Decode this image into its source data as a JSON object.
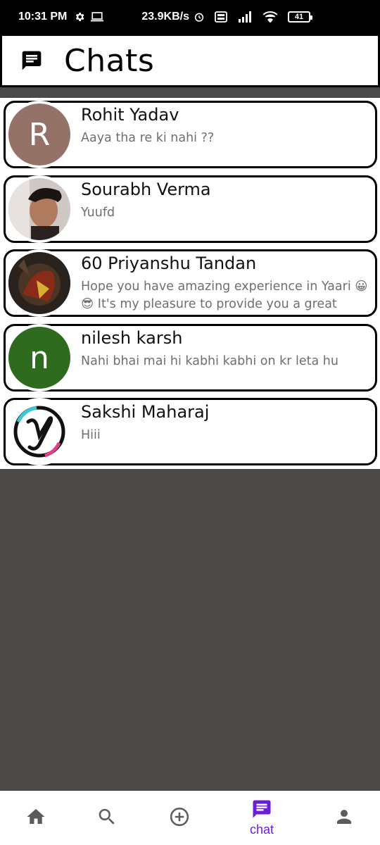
{
  "status_bar": {
    "time": "10:31 PM",
    "speed": "23.9KB/s",
    "battery": "41"
  },
  "header": {
    "title": "Chats",
    "icon": "chat-icon"
  },
  "chats": [
    {
      "name": "Rohit Yadav",
      "message": "Aaya tha re ki nahi ??",
      "avatar_letter": "R",
      "avatar_color": "#957267"
    },
    {
      "name": "Sourabh Verma",
      "message": "Yuufd",
      "avatar_letter": "",
      "avatar_color": "#6a5a55"
    },
    {
      "name": "60 Priyanshu Tandan",
      "message": "Hope you have amazing experience in Yaari 😀😎 It's my pleasure to provide you a great",
      "avatar_letter": "",
      "avatar_color": "#3a2a20"
    },
    {
      "name": "nilesh karsh",
      "message": "Nahi bhai mai hi kabhi kabhi on kr leta hu",
      "avatar_letter": "n",
      "avatar_color": "#2e6b1e"
    },
    {
      "name": "Sakshi Maharaj",
      "message": "Hiii",
      "avatar_letter": "",
      "avatar_color": "#ffffff"
    }
  ],
  "nav": {
    "home_icon": "home-icon",
    "search_icon": "search-icon",
    "add_icon": "add-circle-icon",
    "chat_icon": "chat-icon",
    "chat_label": "chat",
    "profile_icon": "person-icon",
    "active_color": "#6a1fd6"
  }
}
